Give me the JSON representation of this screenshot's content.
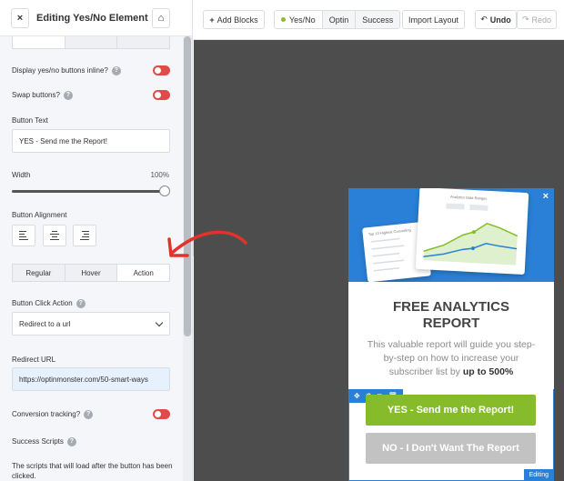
{
  "panel": {
    "title": "Editing Yes/No Element",
    "close_icon": "×",
    "home_icon": "⌂",
    "display_inline_label": "Display yes/no buttons inline?",
    "swap_buttons_label": "Swap buttons?",
    "help_icon": "?",
    "button_text_label": "Button Text",
    "button_text_value": "YES - Send me the Report!",
    "width_label": "Width",
    "width_value": "100%",
    "width_level_percent": 100,
    "alignment_label": "Button Alignment",
    "state_tabs": [
      "Regular",
      "Hover",
      "Action"
    ],
    "active_state_tab": "Action",
    "click_action_label": "Button Click Action",
    "click_action_value": "Redirect to a url",
    "redirect_label": "Redirect URL",
    "redirect_value": "https://optinmonster.com/50-smart-ways",
    "conversion_label": "Conversion tracking?",
    "success_scripts_label": "Success Scripts",
    "success_scripts_desc": "The scripts that will load after the button has been clicked.",
    "collapse_icon": "‹",
    "toggle_color": "#e24a4a"
  },
  "toolbar": {
    "add_blocks_icon": "+",
    "add_blocks": "Add Blocks",
    "views": [
      "Yes/No",
      "Optin",
      "Success"
    ],
    "active_view": "Yes/No",
    "import_layout": "Import Layout",
    "undo_icon": "↶",
    "undo": "Undo",
    "redo_icon": "↷",
    "redo": "Redo"
  },
  "popup": {
    "close_icon": "×",
    "card_title": "Analytics Data Ranges",
    "card_left_title": "Top 10 Highest Converting",
    "title_line1": "FREE ANALYTICS",
    "title_line2": "REPORT",
    "body_text": "This valuable report will guide you step-by-step on how to increase your subscriber list by",
    "body_bold": "up to 500%",
    "yes_button": "YES - Send me the Report!",
    "no_button": "NO - I Don't Want The Report",
    "editing_badge": "Editing",
    "edit_tools": [
      "✥",
      "⚙",
      "⧉",
      "🗑"
    ],
    "accent_color": "#2a80d6",
    "yes_color": "#86bc2b",
    "no_color": "#c2c2c2"
  }
}
